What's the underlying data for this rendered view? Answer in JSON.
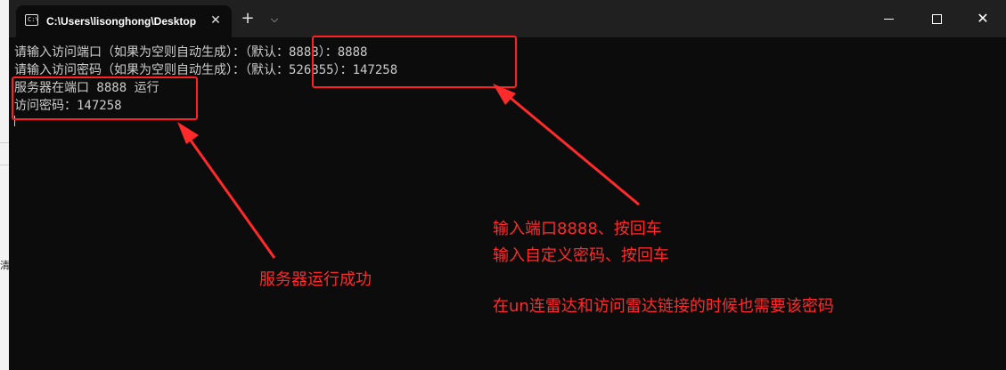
{
  "window": {
    "tab_title": "C:\\Users\\lisonghong\\Desktop",
    "tab_close": "✕",
    "new_tab": "+",
    "dropdown": "⌵",
    "minimize": "",
    "maximize": "",
    "close": "✕"
  },
  "background": {
    "edge_glyph": "清"
  },
  "console": {
    "lines": [
      "请输入访问端口（如果为空则自动生成）：（默认：8888）：8888",
      "请输入访问密码（如果为空则自动生成）：（默认：526855）：147258",
      "服务器在端口 8888 运行",
      "访问密码：147258"
    ]
  },
  "annotations": {
    "server_success": "服务器运行成功",
    "instruction_1": "输入端口8888、按回车",
    "instruction_2": "输入自定义密码、按回车",
    "instruction_3": "在un连雷达和访问雷达链接的时候也需要该密码"
  },
  "colors": {
    "annotation": "#ff2a2a",
    "terminal_bg": "#0c0c0c",
    "titlebar_bg": "#202020",
    "text": "#cccccc"
  }
}
